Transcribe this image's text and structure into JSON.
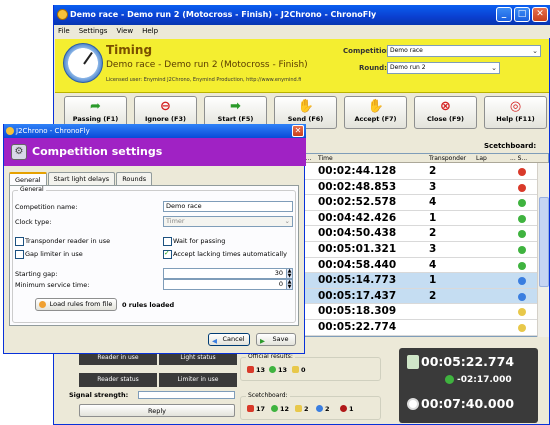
{
  "window": {
    "title": "Demo race - Demo run 2 (Motocross - Finish) - J2Chrono - ChronoFly",
    "minimize_glyph": "_",
    "maximize_glyph": "□",
    "close_glyph": "✕"
  },
  "menu": [
    "File",
    "Settings",
    "View",
    "Help"
  ],
  "header": {
    "title": "Timing",
    "subtitle": "Demo race - Demo run 2 (Motocross - Finish)",
    "license": "Licensed user: Enymind J2Chrono, Enymind Production, http://www.enymind.fi",
    "competition_label": "Competition:",
    "competition_value": "Demo race",
    "round_label": "Round:",
    "round_value": "Demo run 2",
    "dropdown_glyph": "⌄"
  },
  "toolbar": [
    {
      "label": "Passing (F1)",
      "icon": "green-arrow-icon",
      "glyph": "➦",
      "color": "#2a9a2a"
    },
    {
      "label": "Ignore (F3)",
      "icon": "no-entry-icon",
      "glyph": "⊖",
      "color": "#d42020"
    },
    {
      "label": "Start (F5)",
      "icon": "right-arrow-icon",
      "glyph": "➡",
      "color": "#2a9a2a"
    },
    {
      "label": "Send (F6)",
      "icon": "handshake-icon",
      "glyph": "✋",
      "color": "#c08040"
    },
    {
      "label": "Accept (F7)",
      "icon": "handshake-icon",
      "glyph": "✋",
      "color": "#c08040"
    },
    {
      "label": "Close (F9)",
      "icon": "close-circle-icon",
      "glyph": "⊗",
      "color": "#d42020"
    },
    {
      "label": "Help (F11)",
      "icon": "lifebuoy-icon",
      "glyph": "◎",
      "color": "#d42020"
    }
  ],
  "scoreboard_label": "Scetchboard:",
  "grid": {
    "columns": [
      "I...",
      "Time",
      "Transponder",
      "Lap",
      "... S..."
    ],
    "rows": [
      {
        "time": "00:02:44.128",
        "transponder": "2",
        "status": "red",
        "selected": false
      },
      {
        "time": "00:02:48.853",
        "transponder": "3",
        "status": "red",
        "selected": false
      },
      {
        "time": "00:02:52.578",
        "transponder": "4",
        "status": "green",
        "selected": false
      },
      {
        "time": "00:04:42.426",
        "transponder": "1",
        "status": "green",
        "selected": false
      },
      {
        "time": "00:04:50.438",
        "transponder": "2",
        "status": "green",
        "selected": false
      },
      {
        "time": "00:05:01.321",
        "transponder": "3",
        "status": "green",
        "selected": false
      },
      {
        "time": "00:04:58.440",
        "transponder": "4",
        "status": "green",
        "selected": false
      },
      {
        "time": "00:05:14.773",
        "transponder": "1",
        "status": "blue",
        "selected": true
      },
      {
        "time": "00:05:17.437",
        "transponder": "2",
        "status": "blue",
        "selected": true
      },
      {
        "time": "00:05:18.309",
        "transponder": "",
        "status": "yellow",
        "selected": false
      },
      {
        "time": "00:05:22.774",
        "transponder": "",
        "status": "yellow",
        "selected": false
      }
    ]
  },
  "status": {
    "reader_in_use": "Reader in use",
    "light_status": "Light status",
    "reader_status": "Reader status",
    "limiter_in_use": "Limiter in use",
    "signal_label": "Signal strength:",
    "reply": "Reply"
  },
  "official_results": {
    "title": "Official results:",
    "red": "13",
    "green": "13",
    "yellow": "0"
  },
  "scetchboard": {
    "title": "Scetchboard:",
    "red": "17",
    "green": "12",
    "yellow": "2",
    "blue": "2",
    "dark_red": "1"
  },
  "clocks": {
    "current": "00:05:22.774",
    "diff": "-02:17.000",
    "total": "00:07:40.000"
  },
  "dialog": {
    "title": "J2Chrono - ChronoFly",
    "close_glyph": "✕",
    "header": "Competition settings",
    "tabs": [
      "General",
      "Start light delays",
      "Rounds"
    ],
    "group": "General",
    "competition_name_label": "Competition name:",
    "competition_name_value": "Demo race",
    "clock_type_label": "Clock type:",
    "clock_type_value": "Timer",
    "transponder_reader": "Transponder reader in use",
    "wait_for_passing": "Wait for passing",
    "gap_limiter": "Gap limiter in use",
    "accept_lacking": "Accept lacking times automatically",
    "starting_gap_label": "Starting gap:",
    "starting_gap_value": "30",
    "min_service_label": "Minimum service time:",
    "min_service_value": "0",
    "load_rules": "Load rules from file",
    "rules_loaded": "0 rules loaded",
    "cancel": "Cancel",
    "save": "Save"
  },
  "colors": {
    "red": "#d93a2a",
    "green": "#3fb33f",
    "blue": "#3a7ee0",
    "yellow": "#e8c84a",
    "dark_red": "#b01818"
  }
}
